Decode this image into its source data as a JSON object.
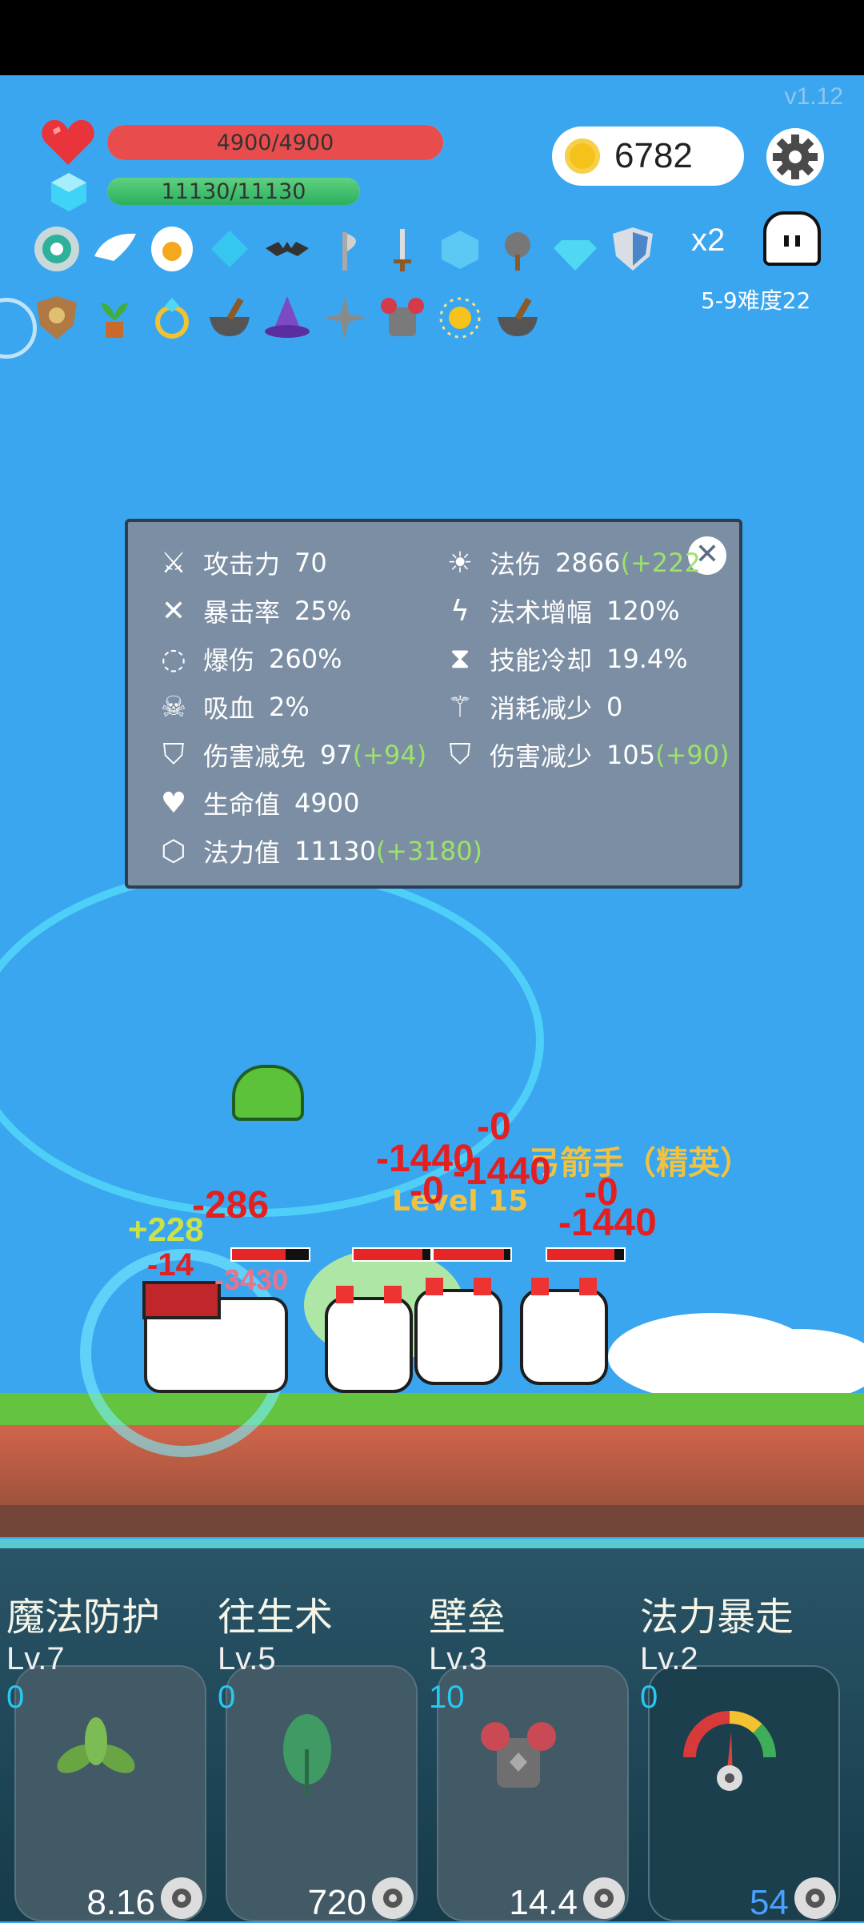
{
  "version": "v1.12",
  "hud": {
    "hp_text": "4900/4900",
    "hp_fraction": 1.0,
    "mp_text": "11130/11130",
    "mp_fraction": 1.0,
    "coins": "6782",
    "multiplier": "x2",
    "difficulty": "5-9难度22"
  },
  "items_row1": [
    "eye-orb",
    "wing",
    "egg",
    "blue-gem",
    "bat",
    "axe",
    "sword",
    "ice-cube",
    "spiked-club",
    "diamond",
    "shield"
  ],
  "items_row2": [
    "wood-shield",
    "potted-plant",
    "ring",
    "mortar",
    "wizard-hat",
    "shuriken",
    "armor",
    "sun-orb",
    "mortar-2"
  ],
  "stats": {
    "attack": {
      "name": "攻击力",
      "value": "70",
      "bonus": ""
    },
    "crit": {
      "name": "暴击率",
      "value": "25%",
      "bonus": ""
    },
    "crit_dmg": {
      "name": "爆伤",
      "value": "260%",
      "bonus": ""
    },
    "lifesteal": {
      "name": "吸血",
      "value": "2%",
      "bonus": ""
    },
    "dmg_reduce_rate": {
      "name": "伤害减免",
      "value": "97",
      "bonus": "(+94)"
    },
    "health": {
      "name": "生命值",
      "value": "4900",
      "bonus": ""
    },
    "mana": {
      "name": "法力值",
      "value": "11130",
      "bonus": "(+3180)"
    },
    "magic_dmg": {
      "name": "法伤",
      "value": "2866",
      "bonus": "(+222"
    },
    "spell_amp": {
      "name": "法术增幅",
      "value": "120%",
      "bonus": ""
    },
    "cooldown": {
      "name": "技能冷却",
      "value": "19.4%",
      "bonus": ""
    },
    "cost_reduce": {
      "name": "消耗减少",
      "value": "0",
      "bonus": ""
    },
    "dmg_reduce": {
      "name": "伤害减少",
      "value": "105",
      "bonus": "(+90)"
    }
  },
  "battle": {
    "damage_numbers": [
      "-0",
      "-1440",
      "-1440",
      "-0",
      "-0",
      "-1440",
      "-14",
      "-3430",
      "-286",
      "+228"
    ],
    "enemy_label": "弓箭手（精英）",
    "enemy_level": "Level 15"
  },
  "skills": [
    {
      "name": "魔法防护",
      "level": "Lv.7",
      "count": "0",
      "value": "8.16",
      "art": "leaf-sprout",
      "value_color": "#ffffff"
    },
    {
      "name": "往生术",
      "level": "Lv.5",
      "count": "0",
      "value": "720",
      "art": "green-leaf",
      "value_color": "#ffffff"
    },
    {
      "name": "壁垒",
      "level": "Lv.3",
      "count": "10",
      "value": "14.4",
      "art": "spiked-armor",
      "value_color": "#ffffff"
    },
    {
      "name": "法力暴走",
      "level": "Lv.2",
      "count": "0",
      "value": "54",
      "art": "gauge-meter",
      "value_color": "#4aa0ff"
    }
  ],
  "colors": {
    "sky": "#3aa6f0",
    "hp": "#e84c4c",
    "mp": "#2bb060",
    "panel": "#7c8ea3",
    "bonus": "#9be36a"
  }
}
